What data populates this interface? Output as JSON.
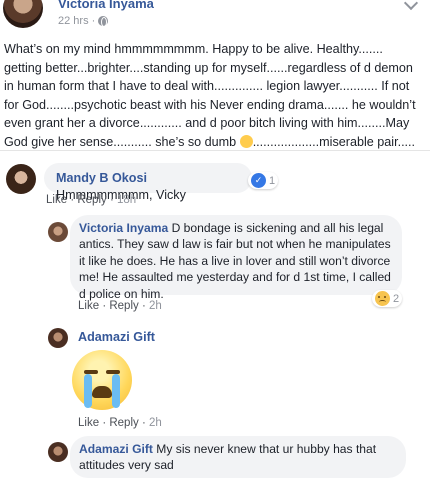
{
  "post": {
    "author": "Victoria Inyama",
    "time": "22 hrs",
    "separator": "·",
    "text_before_emoji": "What’s on my mind hmmmmmmmm. Happy to be alive. Healthy....... getting better...brighter....standing up for myself......regardless of d demon in human form that I have to deal with.............. legion lawyer........... If not for God........psychotic beast with his Never ending drama....... he wouldn’t even grant her a divorce............ and d poor bitch living with him........May God give her sense........... she’s so dumb",
    "text_after_emoji": "...................miserable pair.....",
    "emoji": "thinking-face"
  },
  "comments": [
    {
      "name": "Mandy B Okosi",
      "text": "Hmmmmmmmm, Vicky",
      "like": "Like",
      "reply": "Reply",
      "time": "18h",
      "reaction_count": "1",
      "reaction": "like"
    },
    {
      "name": "Victoria Inyama",
      "text": "D bondage is sickening and all his legal antics. They saw d law is fair but not when he manipulates it like he does. He has a live in lover and still won’t divorce me! He assaulted me yesterday and for d 1st time, I called d police on him.",
      "like": "Like",
      "reply": "Reply",
      "time": "2h",
      "reaction_count": "2",
      "reaction": "sad"
    },
    {
      "name": "Adamazi Gift",
      "text": "",
      "attachment": "crying-face-sticker",
      "like": "Like",
      "reply": "Reply",
      "time": "2h"
    },
    {
      "name": "Adamazi Gift",
      "text": "My sis never knew that ur hubby has that attitudes very sad"
    }
  ],
  "ui": {
    "dot": "·",
    "like_thumb": "👍"
  }
}
